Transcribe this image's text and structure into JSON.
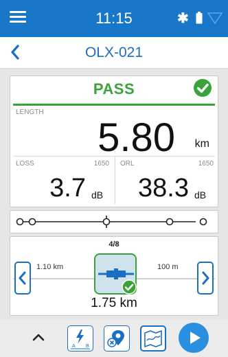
{
  "status_bar": {
    "time": "11:15",
    "background_color": "#1877c9"
  },
  "header": {
    "title": "OLX-021",
    "title_color": "#1a6fc1"
  },
  "result": {
    "status": "PASS",
    "status_color": "#3aa33a",
    "length_label": "LENGTH",
    "length_value": "5.80",
    "length_unit": "km",
    "loss_label": "LOSS",
    "loss_wavelength": "1650",
    "loss_value": "3.7",
    "loss_unit": "dB",
    "orl_label": "ORL",
    "orl_wavelength": "1650",
    "orl_value": "38.3",
    "orl_unit": "dB"
  },
  "event_panel": {
    "count": "4/8",
    "distance_before": "1.10 km",
    "distance_after": "100 m",
    "event_position": "1.75 km",
    "event_icon": "connector-icon"
  },
  "toolbar": {
    "items": [
      "expand-up-icon",
      "measure-ab-icon",
      "fault-locator-icon",
      "map-view-icon",
      "play-icon"
    ]
  }
}
